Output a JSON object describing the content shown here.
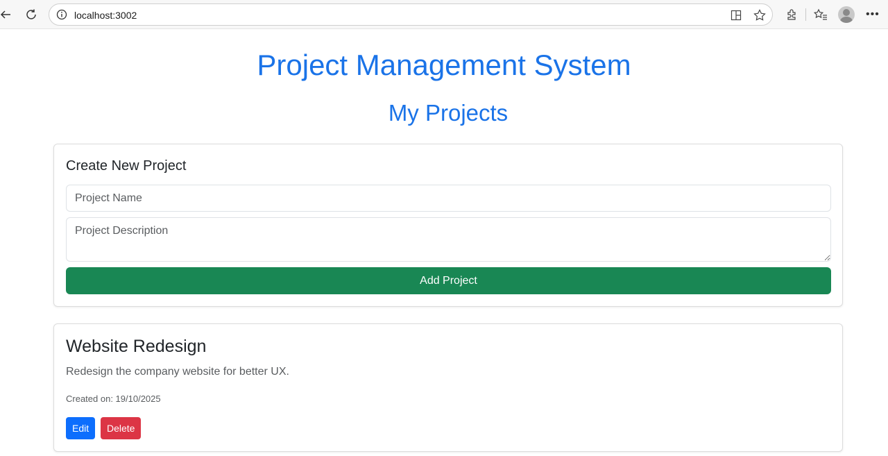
{
  "browser": {
    "url": "localhost:3002",
    "icons": [
      "back-icon",
      "reload-icon",
      "info-icon",
      "split-screen-icon",
      "favorite-icon",
      "extensions-icon",
      "favorites-list-icon",
      "profile-avatar",
      "more-icon"
    ]
  },
  "page": {
    "title": "Project Management System",
    "subtitle": "My Projects"
  },
  "create_form": {
    "heading": "Create New Project",
    "name_placeholder": "Project Name",
    "name_value": "",
    "description_placeholder": "Project Description",
    "description_value": "",
    "submit_label": "Add Project"
  },
  "projects": [
    {
      "name": "Website Redesign",
      "description": "Redesign the company website for better UX.",
      "created": "Created on: 19/10/2025",
      "edit_label": "Edit",
      "delete_label": "Delete"
    }
  ],
  "colors": {
    "title": "#1a73e8",
    "add_button": "#198754",
    "edit_button": "#0d6efd",
    "delete_button": "#dc3545"
  }
}
